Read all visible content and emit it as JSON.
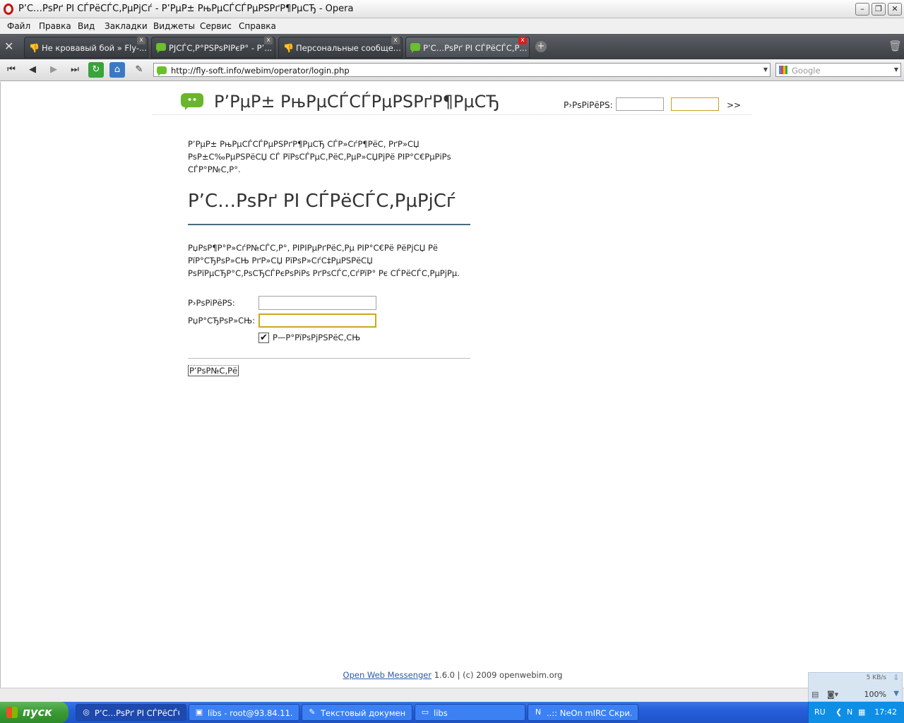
{
  "window": {
    "title": "Р’С…РѕРґ РІ СЃРёСЃС‚РµРјСѓ - Р’РµР± РњРµСЃСЃРµРЅРґР¶РµСЂ - Opera"
  },
  "menu": [
    "Файл",
    "Правка",
    "Вид",
    "Закладки",
    "Виджеты",
    "Сервис",
    "Справка"
  ],
  "tabs": [
    {
      "label": "Не кровавый бой » Fly-..."
    },
    {
      "label": "РЈСЃС‚Р°РЅРѕРІРєР° - Р’..."
    },
    {
      "label": "Персональные сообще..."
    },
    {
      "label": "Р’С…РѕРґ РІ СЃРёСЃС‚Р..."
    }
  ],
  "address": {
    "url": "http://fly-soft.info/webim/operator/login.php",
    "search_placeholder": "Google"
  },
  "page": {
    "site_title": "Р’РµР± РњРµСЃСЃРµРЅРґР¶РµСЂ",
    "header_login_label": "Р›РѕРіРёРЅ:",
    "header_go": ">>",
    "intro": "Р’РµР± РњРµСЃСЃРµРЅРґР¶РµСЂ СЃР»СѓР¶РёС‚ РґР»СЏ РѕР±С‰РµРЅРёСЏ СЃ РїРѕСЃРµС‚РёС‚РµР»СЏРјРё РІР°С€РµРіРѕ СЃР°Р№С‚Р°.",
    "section_title": "Р’С…РѕРґ РІ СЃРёСЃС‚РµРјСѓ",
    "description": "РџРѕР¶Р°Р»СѓР№СЃС‚Р°, РІРІРµРґРёС‚Рµ РІР°С€Рё РёРјСЏ Рё РїР°СЂРѕР»СЊ РґР»СЏ РїРѕР»СѓС‡РµРЅРёСЏ РѕРїРµСЂР°С‚РѕСЂСЃРєРѕРіРѕ РґРѕСЃС‚СѓРїР° Рє СЃРёСЃС‚РµРјРµ.",
    "login_label": "Р›РѕРіРёРЅ:",
    "password_label": "РџР°СЂРѕР»СЊ:",
    "remember_label": "Р—Р°РїРѕРјРЅРёС‚СЊ",
    "remember_checked": true,
    "enter_link": "Р’РѕР№С‚Рё",
    "footer_link": "Open Web Messenger",
    "footer_text": " 1.6.0 | (c) 2009 openwebim.org"
  },
  "status": {
    "speed": "5 KB/s",
    "zoom": "100%"
  },
  "taskbar": {
    "start": "пуск",
    "tasks": [
      {
        "label": "Р’С…РѕРґ РІ СЃРёСЃС..."
      },
      {
        "label": "libs - root@93.84.11...."
      },
      {
        "label": "Текстовый докумен..."
      },
      {
        "label": "libs"
      },
      {
        "label": "..:: NeOn mIRC Скри..."
      }
    ],
    "lang": "RU",
    "clock": "17:42"
  },
  "colors": {
    "brand_green": "#6ab52e",
    "accent_rule": "#4a6b82",
    "link": "#2a5ba8"
  }
}
